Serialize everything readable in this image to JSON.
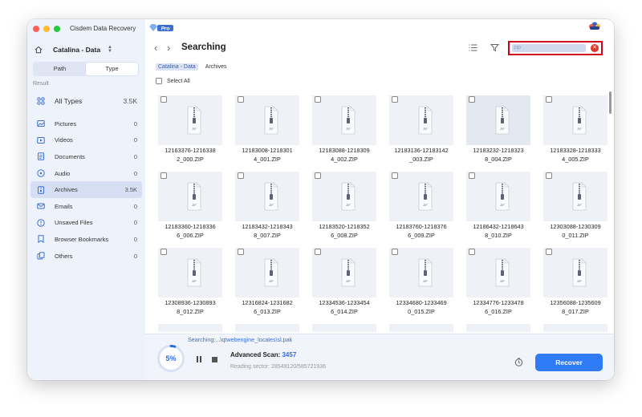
{
  "app": {
    "title": "Cisdem Data Recovery",
    "badge": "Pro"
  },
  "sidebar": {
    "drive": "Catalina - Data",
    "tabs": [
      {
        "label": "Path"
      },
      {
        "label": "Type"
      }
    ],
    "result_label": "Result",
    "categories": [
      {
        "label": "All Types",
        "count": "3.5K",
        "icon": "grid-icon"
      },
      {
        "label": "Pictures",
        "count": "0",
        "icon": "picture-icon"
      },
      {
        "label": "Videos",
        "count": "0",
        "icon": "video-icon"
      },
      {
        "label": "Documents",
        "count": "0",
        "icon": "document-icon"
      },
      {
        "label": "Audio",
        "count": "0",
        "icon": "audio-icon"
      },
      {
        "label": "Archives",
        "count": "3.5K",
        "icon": "archive-icon"
      },
      {
        "label": "Emails",
        "count": "0",
        "icon": "email-icon"
      },
      {
        "label": "Unsaved Files",
        "count": "0",
        "icon": "unsaved-icon"
      },
      {
        "label": "Browser Bookmarks",
        "count": "0",
        "icon": "bookmark-icon"
      },
      {
        "label": "Others",
        "count": "0",
        "icon": "others-icon"
      }
    ]
  },
  "main": {
    "title": "Searching",
    "search": {
      "value": "zip"
    },
    "breadcrumb": [
      "Catalina - Data",
      "Archives"
    ],
    "select_all": "Select All",
    "files": [
      "12163376-12163382_000.ZIP",
      "12183008-12183014_001.ZIP",
      "12183088-12183094_002.ZIP",
      "12183136-12183142_003.ZIP",
      "12183232-12183238_004.ZIP",
      "12183328-12183334_005.ZIP",
      "12183360-12183366_006.ZIP",
      "12183432-12183438_007.ZIP",
      "12183520-12183526_008.ZIP",
      "12183760-12183766_009.ZIP",
      "12186432-12186438_010.ZIP",
      "12303088-12303090_011.ZIP",
      "12308936-12308938_012.ZIP",
      "12316824-12316826_013.ZIP",
      "12334536-12334546_014.ZIP",
      "12334680-12334690_015.ZIP",
      "12334776-12334786_016.ZIP",
      "12356088-12356098_017.ZIP"
    ],
    "file_names_wrapped": [
      [
        "12163376-1216338",
        "2_000.ZIP"
      ],
      [
        "12183008-1218301",
        "4_001.ZIP"
      ],
      [
        "12183088-1218309",
        "4_002.ZIP"
      ],
      [
        "12183136-12183142",
        "_003.ZIP"
      ],
      [
        "12183232-1218323",
        "8_004.ZIP"
      ],
      [
        "12183328-1218333",
        "4_005.ZIP"
      ],
      [
        "12183360-1218336",
        "6_006.ZIP"
      ],
      [
        "12183432-1218343",
        "8_007.ZIP"
      ],
      [
        "12183520-1218352",
        "6_008.ZIP"
      ],
      [
        "12183760-1218376",
        "6_009.ZIP"
      ],
      [
        "12186432-1218643",
        "8_010.ZIP"
      ],
      [
        "12303088-1230309",
        "0_011.ZIP"
      ],
      [
        "12308936-1230893",
        "8_012.ZIP"
      ],
      [
        "12316824-1231682",
        "6_013.ZIP"
      ],
      [
        "12334536-1233454",
        "6_014.ZIP"
      ],
      [
        "12334680-1233469",
        "0_015.ZIP"
      ],
      [
        "12334776-1233478",
        "6_016.ZIP"
      ],
      [
        "12356088-1235609",
        "8_017.ZIP"
      ]
    ],
    "selected_index": 4
  },
  "status": {
    "searching_path": "Searching:...\\qtwebengine_locales\\sl.pak",
    "progress_percent": 5,
    "progress_label": "5%",
    "advanced_scan_label": "Advanced Scan:",
    "advanced_scan_count": "3457",
    "reading_sector": "Reading sector: 28549120/585721936",
    "recover_label": "Recover"
  },
  "colors": {
    "accent": "#2f7bf5",
    "highlight_border": "#d0021b",
    "sidebar_bg": "#eef2fb",
    "active_item": "#d5def3"
  }
}
